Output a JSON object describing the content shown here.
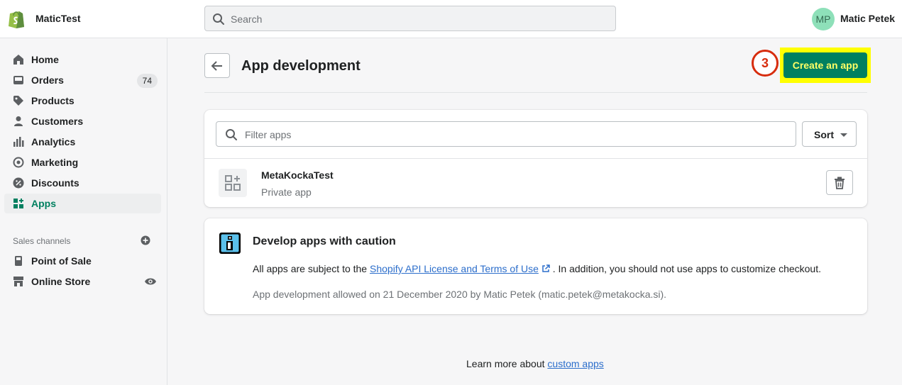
{
  "topbar": {
    "store_name": "MaticTest",
    "search_placeholder": "Search",
    "avatar_initials": "MP",
    "user_name": "Matic Petek"
  },
  "sidebar": {
    "items": [
      {
        "label": "Home",
        "icon": "home-icon"
      },
      {
        "label": "Orders",
        "icon": "orders-icon",
        "badge": "74"
      },
      {
        "label": "Products",
        "icon": "tag-icon"
      },
      {
        "label": "Customers",
        "icon": "person-icon"
      },
      {
        "label": "Analytics",
        "icon": "bar-chart-icon"
      },
      {
        "label": "Marketing",
        "icon": "target-icon"
      },
      {
        "label": "Discounts",
        "icon": "discount-icon"
      },
      {
        "label": "Apps",
        "icon": "apps-icon",
        "active": true
      }
    ],
    "sales_channels_title": "Sales channels",
    "channels": [
      {
        "label": "Point of Sale",
        "icon": "pos-icon"
      },
      {
        "label": "Online Store",
        "icon": "store-icon"
      }
    ]
  },
  "page": {
    "title": "App development",
    "create_button": "Create an app",
    "step_marker": "3"
  },
  "apps_card": {
    "filter_placeholder": "Filter apps",
    "sort_label": "Sort",
    "app": {
      "name": "MetaKockaTest",
      "type": "Private app"
    }
  },
  "caution_card": {
    "title": "Develop apps with caution",
    "body_prefix": "All apps are subject to the ",
    "body_link": "Shopify API License and Terms of Use",
    "body_suffix": " . In addition, you should not use apps to customize checkout.",
    "meta": "App development allowed on 21 December 2020 by Matic Petek (matic.petek@metakocka.si)."
  },
  "footer": {
    "prefix": "Learn more about ",
    "link": "custom apps"
  },
  "colors": {
    "accent": "#008060",
    "highlight": "#ffff00",
    "marker": "#d72c0d",
    "link": "#2c6ecb"
  }
}
